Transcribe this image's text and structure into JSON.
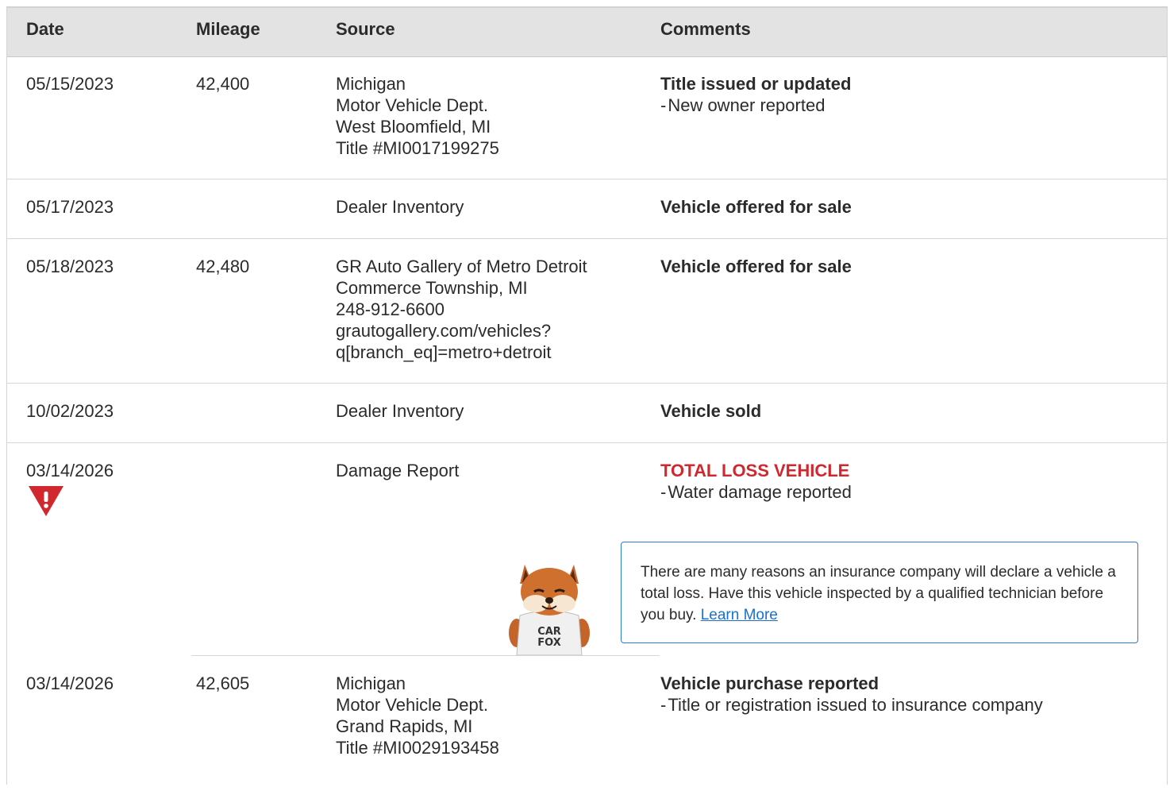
{
  "columns": {
    "date": "Date",
    "mileage": "Mileage",
    "source": "Source",
    "comments": "Comments"
  },
  "rows": [
    {
      "date": "05/15/2023",
      "mileage": "42,400",
      "source": [
        "Michigan",
        "Motor Vehicle Dept.",
        "West Bloomfield, MI",
        "Title #MI0017199275"
      ],
      "comment_title": "Title issued or updated",
      "comment_details": [
        "New owner reported"
      ]
    },
    {
      "date": "05/17/2023",
      "mileage": "",
      "source": [
        "Dealer Inventory"
      ],
      "comment_title": "Vehicle offered for sale",
      "comment_details": []
    },
    {
      "date": "05/18/2023",
      "mileage": "42,480",
      "source": [
        "GR Auto Gallery of Metro Detroit",
        "Commerce Township, MI",
        "248-912-6600",
        "grautogallery.com/vehicles?",
        "q[branch_eq]=metro+detroit"
      ],
      "comment_title": "Vehicle offered for sale",
      "comment_details": []
    },
    {
      "date": "10/02/2023",
      "mileage": "",
      "source": [
        "Dealer Inventory"
      ],
      "comment_title": "Vehicle sold",
      "comment_details": []
    },
    {
      "date": "03/14/2026",
      "mileage": "",
      "source": [
        "Damage Report"
      ],
      "comment_title": "TOTAL LOSS VEHICLE",
      "comment_details": [
        "Water damage reported"
      ],
      "alert": {
        "icon": "warning-triangle-icon",
        "color": "#d0282e",
        "message": "There are many reasons an insurance company will declare a vehicle a total loss. Have this vehicle inspected by a qualified technician before you buy.",
        "link_label": "Learn More",
        "mascot_label": [
          "CAR",
          "FOX"
        ]
      }
    },
    {
      "date": "03/14/2026",
      "mileage": "42,605",
      "source": [
        "Michigan",
        "Motor Vehicle Dept.",
        "Grand Rapids, MI",
        "Title #MI0029193458"
      ],
      "comment_title": "Vehicle purchase reported",
      "comment_details": [
        "Title or registration issued to insurance company"
      ]
    }
  ],
  "colors": {
    "header_bg": "#e3e3e3",
    "alert_red": "#d0282e",
    "link_blue": "#1a6fd0",
    "box_border": "#2a7ad0"
  }
}
